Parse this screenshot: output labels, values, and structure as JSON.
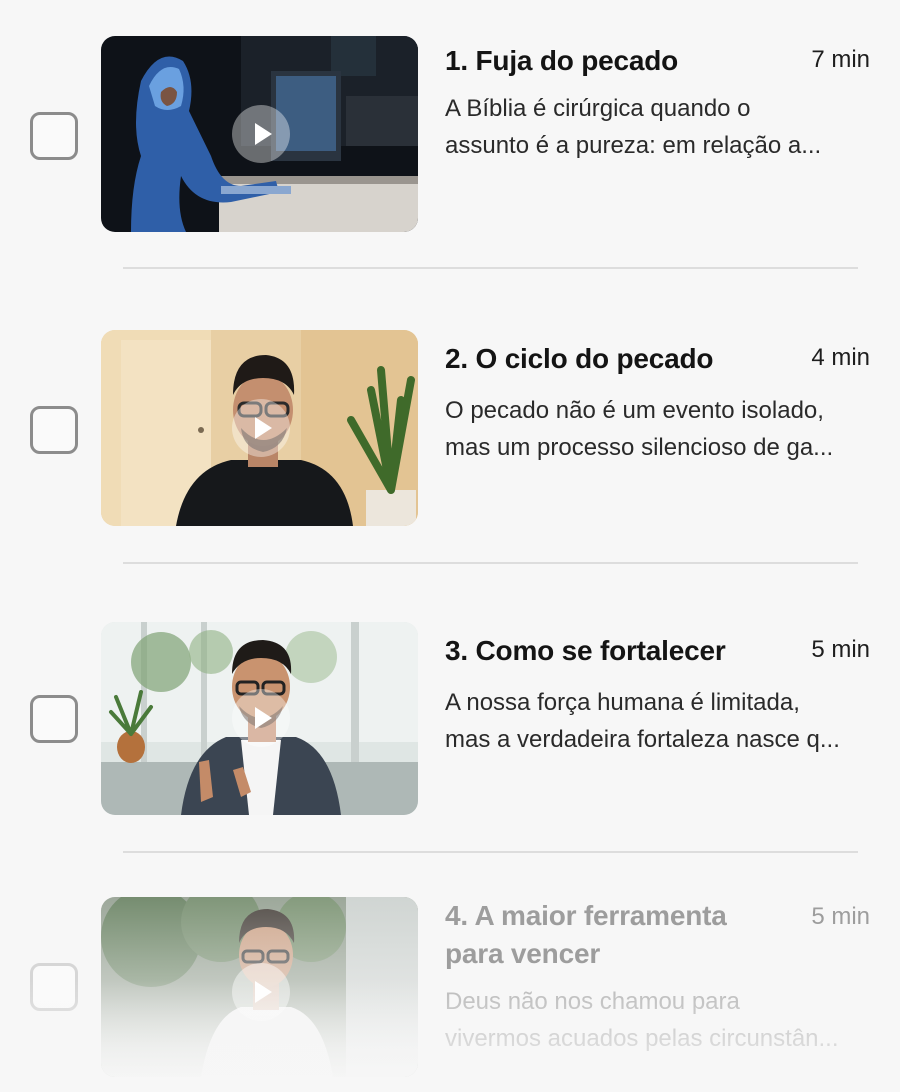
{
  "lessons": [
    {
      "title": "1. Fuja do pecado",
      "duration": "7 min",
      "description_line1": "A Bíblia é cirúrgica quando o",
      "description_line2": "assunto é a pureza: em relação a..."
    },
    {
      "title": "2. O ciclo do pecado",
      "duration": "4 min",
      "description_line1": "O pecado não é um evento isolado,",
      "description_line2": "mas um processo silencioso de ga..."
    },
    {
      "title": "3. Como se fortalecer",
      "duration": "5 min",
      "description_line1": "A nossa força humana é limitada,",
      "description_line2": "mas a verdadeira fortaleza nasce q..."
    },
    {
      "title_line1": "4. A maior ferramenta",
      "title_line2": "para vencer",
      "duration": "5 min",
      "description_line1": "Deus não nos chamou para",
      "description_line2": "vivermos acuados pelas circunstân..."
    }
  ],
  "icons": {
    "checkbox": "checkbox-unchecked-icon",
    "play": "play-icon"
  },
  "colors": {
    "background": "#f7f7f7",
    "title": "#141414",
    "muted": "#9d9d9d",
    "checkbox_border": "#8c8c8c",
    "divider": "#dddddd"
  }
}
